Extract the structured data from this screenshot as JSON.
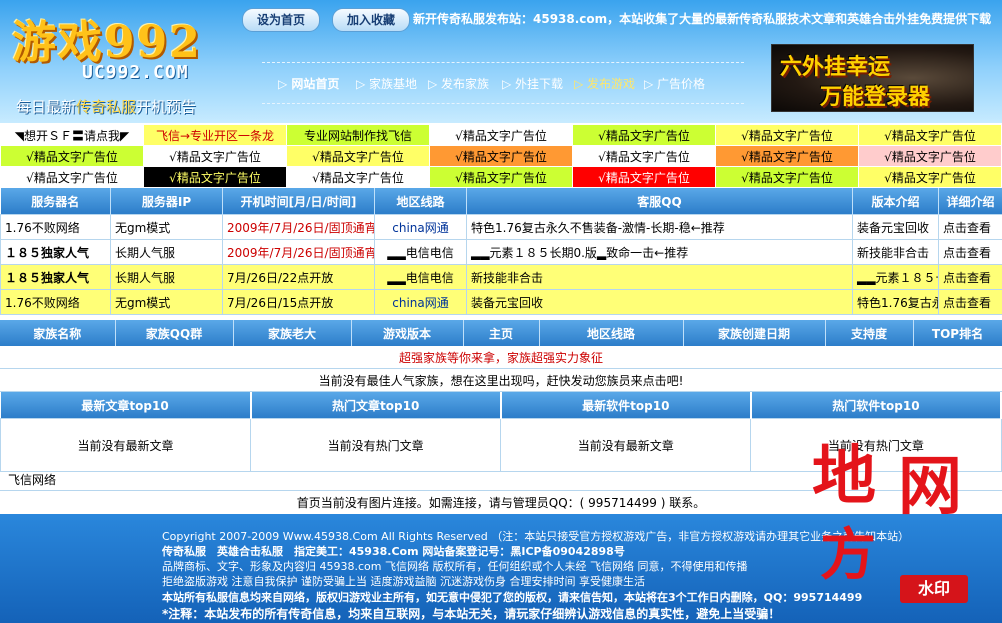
{
  "header": {
    "logo_text": "游戏992",
    "domain": "UC992.COM",
    "tagline_pre": "每日最新",
    "tagline_hl": "传奇私服",
    "tagline_post": "开机预告",
    "set_home": "设为首页",
    "add_fav": "加入收藏",
    "marquee": "新开传奇私服发布站：45938.com，本站收集了大量的最新传奇私服技术文章和英雄合击外挂免费提供下载",
    "nav": [
      "网站首页",
      "家族基地",
      "发布家族",
      "外挂下载",
      "发布游戏",
      "广告价格"
    ],
    "ad_line1": "六外挂幸运",
    "ad_line2": "万能登录器"
  },
  "ad_grid": [
    [
      "◥想开ＳＦ〓请点我◤",
      "飞信→专业开区一条龙",
      "专业网站制作找飞信",
      "√精品文字广告位",
      "√精品文字广告位",
      "√精品文字广告位",
      "√精品文字广告位"
    ],
    [
      "√精品文字广告位",
      "√精品文字广告位",
      "√精品文字广告位",
      "√精品文字广告位",
      "√精品文字广告位",
      "√精品文字广告位",
      "√精品文字广告位"
    ],
    [
      "√精品文字广告位",
      "√精品文字广告位",
      "√精品文字广告位",
      "√精品文字广告位",
      "√精品文字广告位",
      "√精品文字广告位",
      "√精品文字广告位"
    ]
  ],
  "servers": {
    "headers": [
      "服务器名",
      "服务器IP",
      "开机时间[月/日/时间]",
      "地区线路",
      "客服QQ",
      "版本介绍",
      "详细介绍"
    ],
    "rows": [
      {
        "name": "1.76不败网络",
        "ip": "无gm模式",
        "time": "2009年/7月/26日/固顶通宵",
        "line": "china网通",
        "intro": "特色1.76复古永久不售装备-激情-长期-稳←推荐",
        "version": "装备元宝回收",
        "detail": "点击查看"
      },
      {
        "name": "１８５独家人气",
        "ip": "长期人气服",
        "time": "2009年/7月/26日/固顶通宵",
        "line": "▂▂电信电信",
        "intro": "▂▂元素１８５长期0.版▂致命一击←推荐",
        "version": "新技能非合击",
        "detail": "点击查看"
      },
      {
        "name": "１８５独家人气",
        "ip": "长期人气服",
        "time": "7月/26日/22点开放",
        "line": "▂▂电信电信",
        "version": "新技能非合击",
        "intro": "▂▂元素１８５长期0.版▂致命一击←←推荐",
        "detail": "点击查看"
      },
      {
        "name": "1.76不败网络",
        "ip": "无gm模式",
        "time": "7月/26日/15点开放",
        "line": "china网通",
        "version": "装备元宝回收",
        "intro": "特色1.76复古永久不售装备-激情-长期-稳←←推荐",
        "detail": "点击查看"
      }
    ]
  },
  "family": {
    "headers": [
      "家族名称",
      "家族QQ群",
      "家族老大",
      "游戏版本",
      "主页",
      "地区线路",
      "家族创建日期",
      "支持度",
      "TOP排名"
    ],
    "slogan": "超强家族等你来拿，家族超强实力象征",
    "empty": "当前没有最佳人气家族，想在这里出现吗，赶快发动您族员来点击吧!"
  },
  "top10": {
    "headers": [
      "最新文章top10",
      "热门文章top10",
      "最新软件top10",
      "热门软件top10"
    ],
    "cells": [
      "当前没有最新文章",
      "当前没有热门文章",
      "当前没有最新文章",
      "当前没有热门文章"
    ]
  },
  "friend_link": "飞信网络",
  "image_links": "首页当前没有图片连接。如需连接，请与管理员QQ：( 995714499 ) 联系。",
  "footer": {
    "line1": "Copyright 2007-2009 Www.45938.Com All Rights Reserved （注：本站只接受官方授权游戏广告，非官方授权游戏请办理其它业务之前告知本站）",
    "line2": "传奇私服　英雄合击私服　指定美工：45938.Com 网站备案登记号：黑ICP备09042898号",
    "line3": "品牌商标、文字、形象及内容归 45938.com 飞信网络 版权所有，任何组织或个人未经 飞信网络 同意，不得使用和传播",
    "line4": "拒绝盗版游戏 注意自我保护 谨防受骗上当 适度游戏益脑 沉迷游戏伤身 合理安排时间 享受健康生活",
    "line5": "本站所有私服信息均来自网络，版权归游戏业主所有，如无意中侵犯了您的版权，请来信告知，本站将在3个工作日内删除，QQ：995714499",
    "line6": "*注释：本站发布的所有传奇信息，均来自互联网，与本站无关，请玩家仔细辨认游戏信息的真实性，避免上当受骗！"
  },
  "watermark": {
    "c1": "地",
    "c2": "网",
    "c3": "方",
    "badge": "水印"
  }
}
